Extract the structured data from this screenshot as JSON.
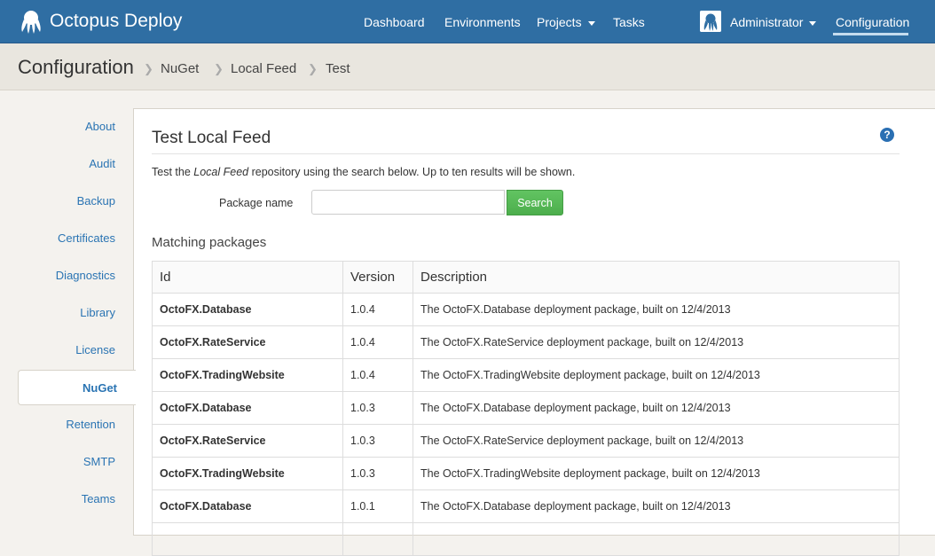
{
  "app": {
    "name": "Octopus Deploy"
  },
  "topnav": {
    "dashboard": "Dashboard",
    "environments": "Environments",
    "projects": "Projects",
    "tasks": "Tasks",
    "user": "Administrator",
    "configuration": "Configuration"
  },
  "breadcrumb": {
    "title": "Configuration",
    "items": [
      "NuGet",
      "Local Feed",
      "Test"
    ]
  },
  "sidebar": {
    "items": [
      "About",
      "Audit",
      "Backup",
      "Certificates",
      "Diagnostics",
      "Library",
      "License",
      "NuGet",
      "Retention",
      "SMTP",
      "Teams"
    ],
    "active": "NuGet"
  },
  "panel": {
    "title": "Test Local Feed",
    "help_label": "?",
    "desc_before": "Test the ",
    "desc_feed": "Local Feed",
    "desc_after": " repository using the search below. Up to ten results will be shown.",
    "package_label": "Package name",
    "package_value": "",
    "search_label": "Search",
    "matching_label": "Matching packages"
  },
  "table": {
    "columns": [
      "Id",
      "Version",
      "Description"
    ],
    "rows": [
      {
        "id": "OctoFX.Database",
        "version": "1.0.4",
        "description": "The OctoFX.Database deployment package, built on 12/4/2013"
      },
      {
        "id": "OctoFX.RateService",
        "version": "1.0.4",
        "description": "The OctoFX.RateService deployment package, built on 12/4/2013"
      },
      {
        "id": "OctoFX.TradingWebsite",
        "version": "1.0.4",
        "description": "The OctoFX.TradingWebsite deployment package, built on 12/4/2013"
      },
      {
        "id": "OctoFX.Database",
        "version": "1.0.3",
        "description": "The OctoFX.Database deployment package, built on 12/4/2013"
      },
      {
        "id": "OctoFX.RateService",
        "version": "1.0.3",
        "description": "The OctoFX.RateService deployment package, built on 12/4/2013"
      },
      {
        "id": "OctoFX.TradingWebsite",
        "version": "1.0.3",
        "description": "The OctoFX.TradingWebsite deployment package, built on 12/4/2013"
      },
      {
        "id": "OctoFX.Database",
        "version": "1.0.1",
        "description": "The OctoFX.Database deployment package, built on 12/4/2013"
      }
    ]
  },
  "colors": {
    "header": "#2f6ea3",
    "link": "#2a74b3",
    "search_button": "#5cb85c",
    "background": "#f4f2ee"
  },
  "icons": {
    "logo": "octopus-logo-icon",
    "help": "help-icon",
    "avatar": "user-avatar-icon"
  }
}
